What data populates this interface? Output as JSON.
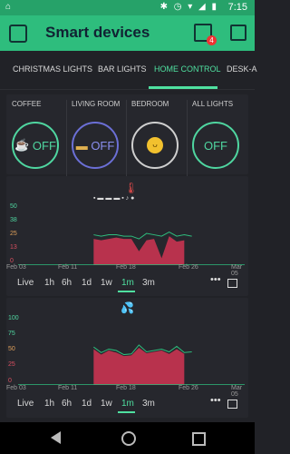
{
  "status": {
    "time": "7:15"
  },
  "app": {
    "title": "Smart devices",
    "badge_count": "4"
  },
  "tabs": [
    {
      "label": "CHRISTMAS LIGHTS"
    },
    {
      "label": "BAR LIGHTS"
    },
    {
      "label": "HOME CONTROL"
    },
    {
      "label": "DESK-A"
    }
  ],
  "buttons": [
    {
      "label": "COFFEE",
      "state": "OFF",
      "icon": "coffee-icon"
    },
    {
      "label": "LIVING ROOM",
      "state": "OFF",
      "icon": "couch-lamp-icon"
    },
    {
      "label": "BEDROOM",
      "state": "",
      "icon": "sleeping-face-icon"
    },
    {
      "label": "ALL LIGHTS",
      "state": "OFF",
      "icon": ""
    }
  ],
  "periods": [
    "Live",
    "1h",
    "6h",
    "1d",
    "1w",
    "1m",
    "3m"
  ],
  "chart_data": [
    {
      "type": "area",
      "title": "",
      "y_ticks": [
        "50",
        "38",
        "25",
        "13",
        "0"
      ],
      "y_tick_colors": [
        "#4fd6a0",
        "#4fd6a0",
        "#e0a05a",
        "#d94f60",
        "#d94f60"
      ],
      "x_ticks": [
        "Feb 03",
        "Feb 11",
        "Feb 18",
        "Feb 26",
        "Mar 05"
      ],
      "ylim": [
        0,
        50
      ],
      "x": [
        "Feb 13",
        "Feb 14",
        "Feb 15",
        "Feb 16",
        "Feb 17",
        "Feb 18",
        "Feb 19",
        "Feb 20",
        "Feb 21",
        "Feb 22",
        "Feb 23",
        "Feb 24",
        "Feb 25",
        "Feb 26"
      ],
      "series": [
        {
          "values": [
            22,
            21,
            22,
            22,
            21,
            21,
            19,
            23,
            22,
            21,
            24,
            21,
            22,
            21
          ]
        },
        {
          "values": [
            19,
            18,
            19,
            20,
            19,
            19,
            10,
            18,
            19,
            5,
            21,
            17,
            18,
            null
          ]
        }
      ],
      "colors": {
        "line": "#2ebd7d",
        "fill": "#b8324d"
      }
    },
    {
      "type": "area",
      "title": "",
      "y_ticks": [
        "100",
        "75",
        "50",
        "25",
        "0"
      ],
      "y_tick_colors": [
        "#4fd6a0",
        "#4fd6a0",
        "#e0a05a",
        "#d94f60",
        "#d94f60"
      ],
      "x_ticks": [
        "Feb 03",
        "Feb 11",
        "Feb 18",
        "Feb 26",
        "Mar 05"
      ],
      "ylim": [
        0,
        100
      ],
      "x": [
        "Feb 13",
        "Feb 14",
        "Feb 15",
        "Feb 16",
        "Feb 17",
        "Feb 18",
        "Feb 19",
        "Feb 20",
        "Feb 21",
        "Feb 22",
        "Feb 23",
        "Feb 24",
        "Feb 25",
        "Feb 26"
      ],
      "series": [
        {
          "values": [
            55,
            47,
            52,
            50,
            44,
            45,
            58,
            48,
            50,
            52,
            48,
            56,
            47,
            48
          ]
        },
        {
          "values": [
            52,
            44,
            50,
            47,
            42,
            43,
            54,
            46,
            48,
            50,
            45,
            52,
            45,
            null
          ]
        }
      ],
      "colors": {
        "line": "#2ebd7d",
        "fill": "#b8324d"
      }
    }
  ]
}
